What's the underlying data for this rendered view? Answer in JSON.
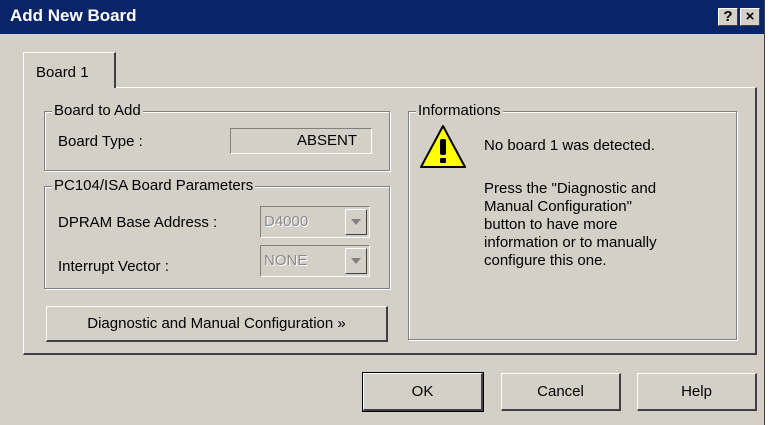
{
  "window": {
    "title": "Add New Board"
  },
  "title_buttons": {
    "help": "?",
    "close": "×"
  },
  "tab": {
    "label": "Board 1"
  },
  "board_to_add": {
    "legend": "Board to Add",
    "type_label": "Board Type :",
    "type_value": "ABSENT"
  },
  "pc104": {
    "legend": "PC104/ISA Board Parameters",
    "dpram_label": "DPRAM Base Address :",
    "dpram_value": "D4000",
    "interrupt_label": "Interrupt Vector :",
    "interrupt_value": "NONE"
  },
  "diagnostic_button": "Diagnostic and Manual Configuration »",
  "info": {
    "legend": "Informations",
    "line1": "No board 1 was detected.",
    "line2": "Press the \"Diagnostic and",
    "line3": "Manual Configuration\"",
    "line4": "button to have more",
    "line5": "information or to manually",
    "line6": "configure this one."
  },
  "buttons": {
    "ok": "OK",
    "cancel": "Cancel",
    "help": "Help"
  },
  "colors": {
    "titlebar": "#0a246a",
    "face": "#d4d0c8",
    "warning": "#ffff00"
  },
  "icons": {
    "warning": "warning-icon",
    "help": "help-icon",
    "close": "close-icon",
    "dropdown": "chevron-down-icon"
  }
}
